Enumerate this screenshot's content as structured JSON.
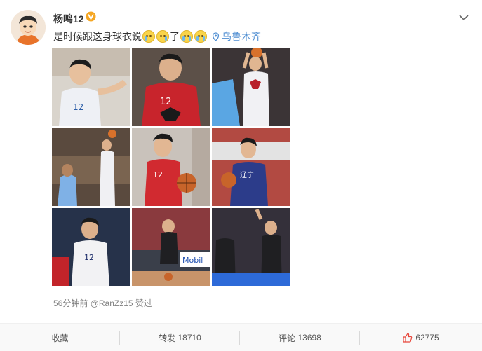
{
  "user": {
    "name": "杨鸣12",
    "verified_badge": "V",
    "avatar_icon": "cartoon-avatar"
  },
  "post": {
    "text": "是时候跟这身球衣说",
    "text_after_emojis": "了",
    "emojis_before": [
      "cry-laugh-emoji",
      "cry-laugh-emoji"
    ],
    "emojis_after": [
      "crying-emoji",
      "crying-emoji"
    ],
    "location": "乌鲁木齐",
    "location_icon": "location-pin-icon"
  },
  "photos_count": 9,
  "meta": {
    "time": "56分钟前",
    "author": "@RanZz15",
    "action": "赞过"
  },
  "actions": {
    "collect": "收藏",
    "repost_label": "转发",
    "repost_count": "18710",
    "comment_label": "评论",
    "comment_count": "13698",
    "like_count": "62775"
  },
  "colors": {
    "link": "#4f8ed2",
    "badge": "#f5a623",
    "like": "#e8463a"
  }
}
